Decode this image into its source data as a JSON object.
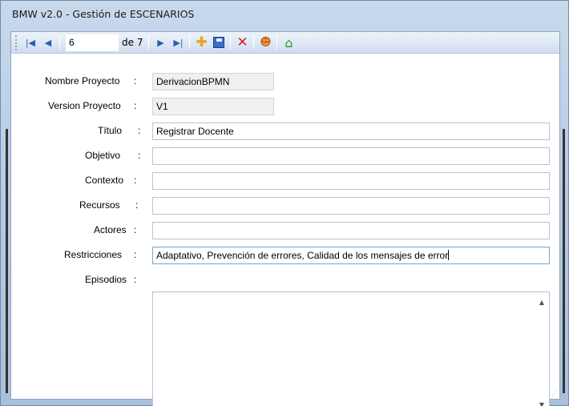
{
  "window": {
    "title": "BMW v2.0 - Gestión de ESCENARIOS"
  },
  "toolbar": {
    "position_value": "6",
    "of_label": "de 7",
    "icons": [
      "move-first-icon",
      "move-previous-icon",
      "move-next-icon",
      "move-last-icon",
      "add-icon",
      "save-icon",
      "delete-icon",
      "people-icon",
      "home-icon"
    ]
  },
  "form": {
    "nombre_proyecto": {
      "label": "Nombre Proyecto",
      "value": "DerivacionBPMN"
    },
    "version_proyecto": {
      "label": "Version Proyecto",
      "value": "V1"
    },
    "titulo": {
      "label": "Título",
      "value": "Registrar Docente"
    },
    "objetivo": {
      "label": "Objetivo",
      "value": ""
    },
    "contexto": {
      "label": "Contexto",
      "value": ""
    },
    "recursos": {
      "label": "Recursos",
      "value": ""
    },
    "actores": {
      "label": "Actores",
      "value": ""
    },
    "restricciones": {
      "label": "Restricciones",
      "value": "Adaptativo, Prevención de errores, Calidad de los mensajes de error"
    },
    "episodios": {
      "label": "Episodios",
      "value": ""
    },
    "colon": ":"
  }
}
